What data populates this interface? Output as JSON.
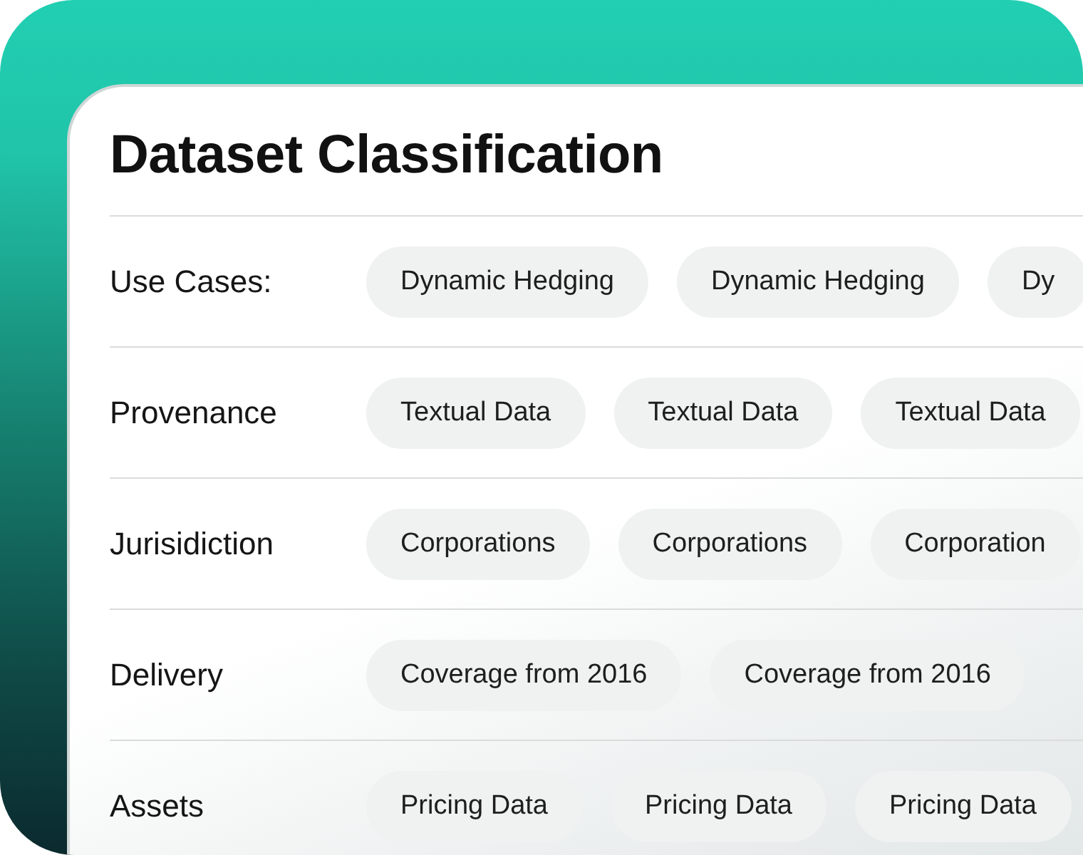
{
  "title": "Dataset Classification",
  "rows": [
    {
      "label": "Use Cases:",
      "chips": [
        "Dynamic Hedging",
        "Dynamic Hedging",
        "Dy"
      ]
    },
    {
      "label": "Provenance",
      "chips": [
        "Textual Data",
        "Textual Data",
        "Textual Data"
      ]
    },
    {
      "label": "Jurisidiction",
      "chips": [
        "Corporations",
        "Corporations",
        "Corporation"
      ]
    },
    {
      "label": "Delivery",
      "chips": [
        "Coverage from 2016",
        "Coverage from 2016"
      ]
    },
    {
      "label": "Assets",
      "chips": [
        "Pricing Data",
        "Pricing Data",
        "Pricing Data"
      ]
    }
  ]
}
